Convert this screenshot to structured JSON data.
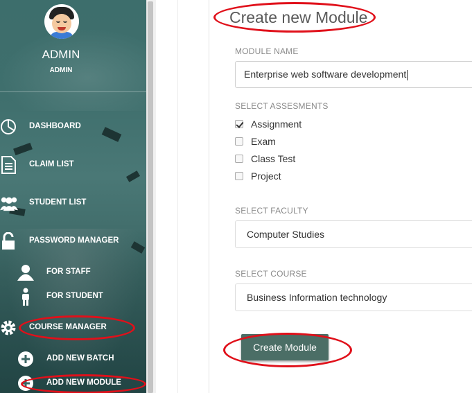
{
  "user": {
    "name": "ADMIN",
    "role": "ADMIN"
  },
  "sidebar": {
    "items": [
      {
        "label": "DASHBOARD",
        "icon": "dashboard-icon"
      },
      {
        "label": "CLAIM LIST",
        "icon": "document-icon"
      },
      {
        "label": "STUDENT LIST",
        "icon": "users-icon"
      },
      {
        "label": "PASSWORD MANAGER",
        "icon": "unlock-icon"
      },
      {
        "label": "FOR STAFF",
        "icon": "user-icon"
      },
      {
        "label": "FOR STUDENT",
        "icon": "person-icon"
      },
      {
        "label": "COURSE MANAGER",
        "icon": "gear-icon"
      },
      {
        "label": "ADD NEW BATCH",
        "icon": "plus-circle-icon"
      },
      {
        "label": "ADD NEW MODULE",
        "icon": "plus-circle-icon"
      }
    ]
  },
  "form": {
    "title": "Create new Module",
    "module_name_label": "MODULE NAME",
    "module_name_value": "Enterprise web software development",
    "assessments_label": "SELECT ASSESMENTS",
    "assessments": [
      {
        "label": "Assignment",
        "checked": true
      },
      {
        "label": "Exam",
        "checked": false
      },
      {
        "label": "Class Test",
        "checked": false
      },
      {
        "label": "Project",
        "checked": false
      }
    ],
    "faculty_label": "SELECT FACULTY",
    "faculty_value": "Computer Studies",
    "course_label": "SELECT COURSE",
    "course_value": "Business Information technology",
    "submit_label": "Create Module"
  },
  "colors": {
    "sidebar_bg": "#3f6f6d",
    "button_bg": "#4b6e66",
    "annotation": "#e0101a"
  }
}
